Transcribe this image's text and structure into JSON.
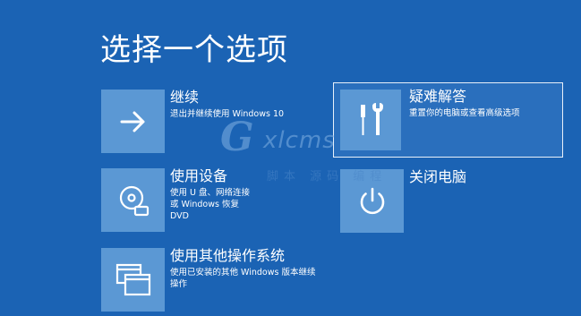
{
  "title": "选择一个选项",
  "options": {
    "continue": {
      "label": "继续",
      "desc": "退出并继续使用 Windows 10",
      "icon": "arrow-right-icon"
    },
    "device": {
      "label": "使用设备",
      "desc": "使用 U 盘、网络连接或 Windows 恢复 DVD",
      "icon": "disc-drive-icon"
    },
    "other_os": {
      "label": "使用其他操作系统",
      "desc": "使用已安装的其他 Windows 版本继续操作",
      "icon": "windows-stack-icon"
    },
    "troubleshoot": {
      "label": "疑难解答",
      "desc": "重置你的电脑或查看高级选项",
      "icon": "tools-icon"
    },
    "shutdown": {
      "label": "关闭电脑",
      "icon": "power-icon"
    }
  },
  "watermark": {
    "logo": "G",
    "brand": "xlcms",
    "sub": "脚本 源码 编程"
  },
  "colors": {
    "background": "#1b63b4",
    "tile": "#5b98d4",
    "text": "#ffffff"
  }
}
